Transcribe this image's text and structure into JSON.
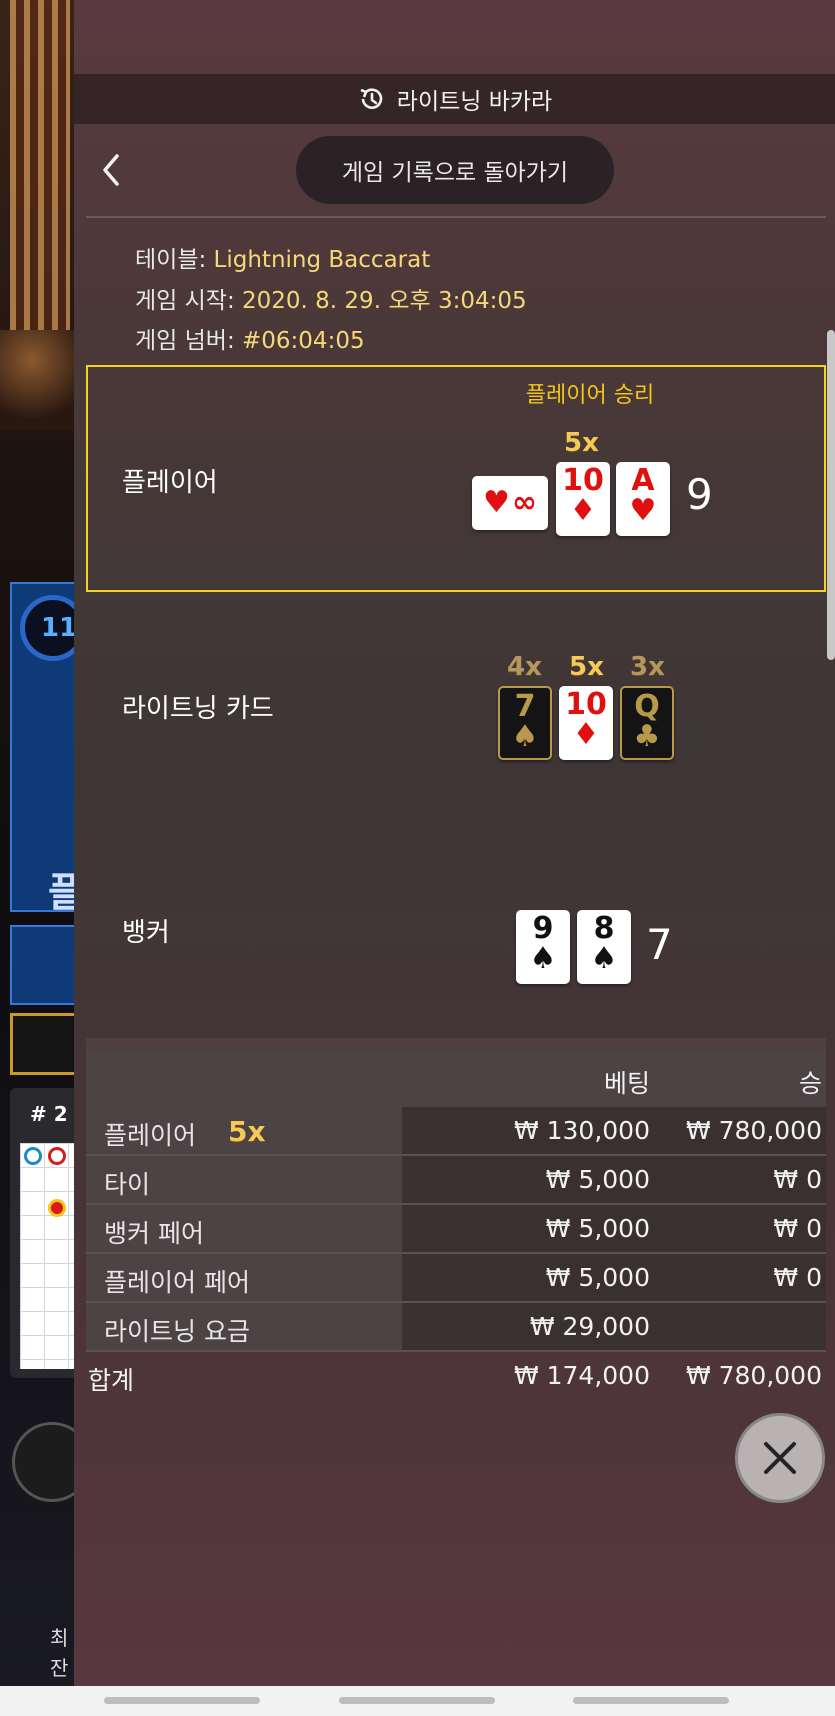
{
  "header": {
    "title": "라이트닝 바카라"
  },
  "nav": {
    "return_label": "게임 기록으로 돌아가기"
  },
  "info": {
    "table_key": "테이블:",
    "table_value": "Lightning Baccarat",
    "start_key": "게임 시작:",
    "start_value": "2020. 8. 29. 오후 3:04:05",
    "number_key": "게임 넘버:",
    "number_value": "#06:04:05"
  },
  "result": {
    "winner_label": "플레이어 승리"
  },
  "player": {
    "label": "플레이어",
    "multiplier": "5x",
    "score": "9",
    "cards": [
      {
        "rank": "∞",
        "suit": "♥",
        "color": "#e01010"
      },
      {
        "rank": "10",
        "suit": "♦",
        "color": "#e01010"
      },
      {
        "rank": "A",
        "suit": "♥",
        "color": "#e01010"
      }
    ]
  },
  "lightning": {
    "label": "라이트닝 카드",
    "cards": [
      {
        "rank": "7",
        "suit": "♠",
        "mult": "4x",
        "color": "#b8984a"
      },
      {
        "rank": "10",
        "suit": "♦",
        "mult": "5x",
        "color": "#e01010"
      },
      {
        "rank": "Q",
        "suit": "♣",
        "mult": "3x",
        "color": "#b8984a"
      }
    ]
  },
  "banker": {
    "label": "뱅커",
    "score": "7",
    "cards": [
      {
        "rank": "9",
        "suit": "♠",
        "color": "#111111"
      },
      {
        "rank": "8",
        "suit": "♠",
        "color": "#111111"
      }
    ]
  },
  "bets": {
    "col_bet": "베팅",
    "col_win": "승",
    "rows": [
      {
        "label": "플레이어",
        "mult": "5x",
        "bet": "₩ 130,000",
        "win": "₩ 780,000"
      },
      {
        "label": "타이",
        "bet": "₩ 5,000",
        "win": "₩ 0"
      },
      {
        "label": "뱅커 페어",
        "bet": "₩ 5,000",
        "win": "₩ 0"
      },
      {
        "label": "플레이어 페어",
        "bet": "₩ 5,000",
        "win": "₩ 0"
      },
      {
        "label": "라이트닝 요금",
        "bet": "₩ 29,000",
        "win": ""
      }
    ],
    "total_label": "합계",
    "total_bet": "₩ 174,000",
    "total_win": "₩ 780,000"
  },
  "background": {
    "timer": "11",
    "side_label": "플",
    "road_hash": "# 2",
    "footer_line1": "최",
    "footer_line2": "잔"
  },
  "colors": {
    "accent_gold": "#f2d320",
    "winner_text": "#f5c518",
    "info_value": "#f5d878"
  }
}
